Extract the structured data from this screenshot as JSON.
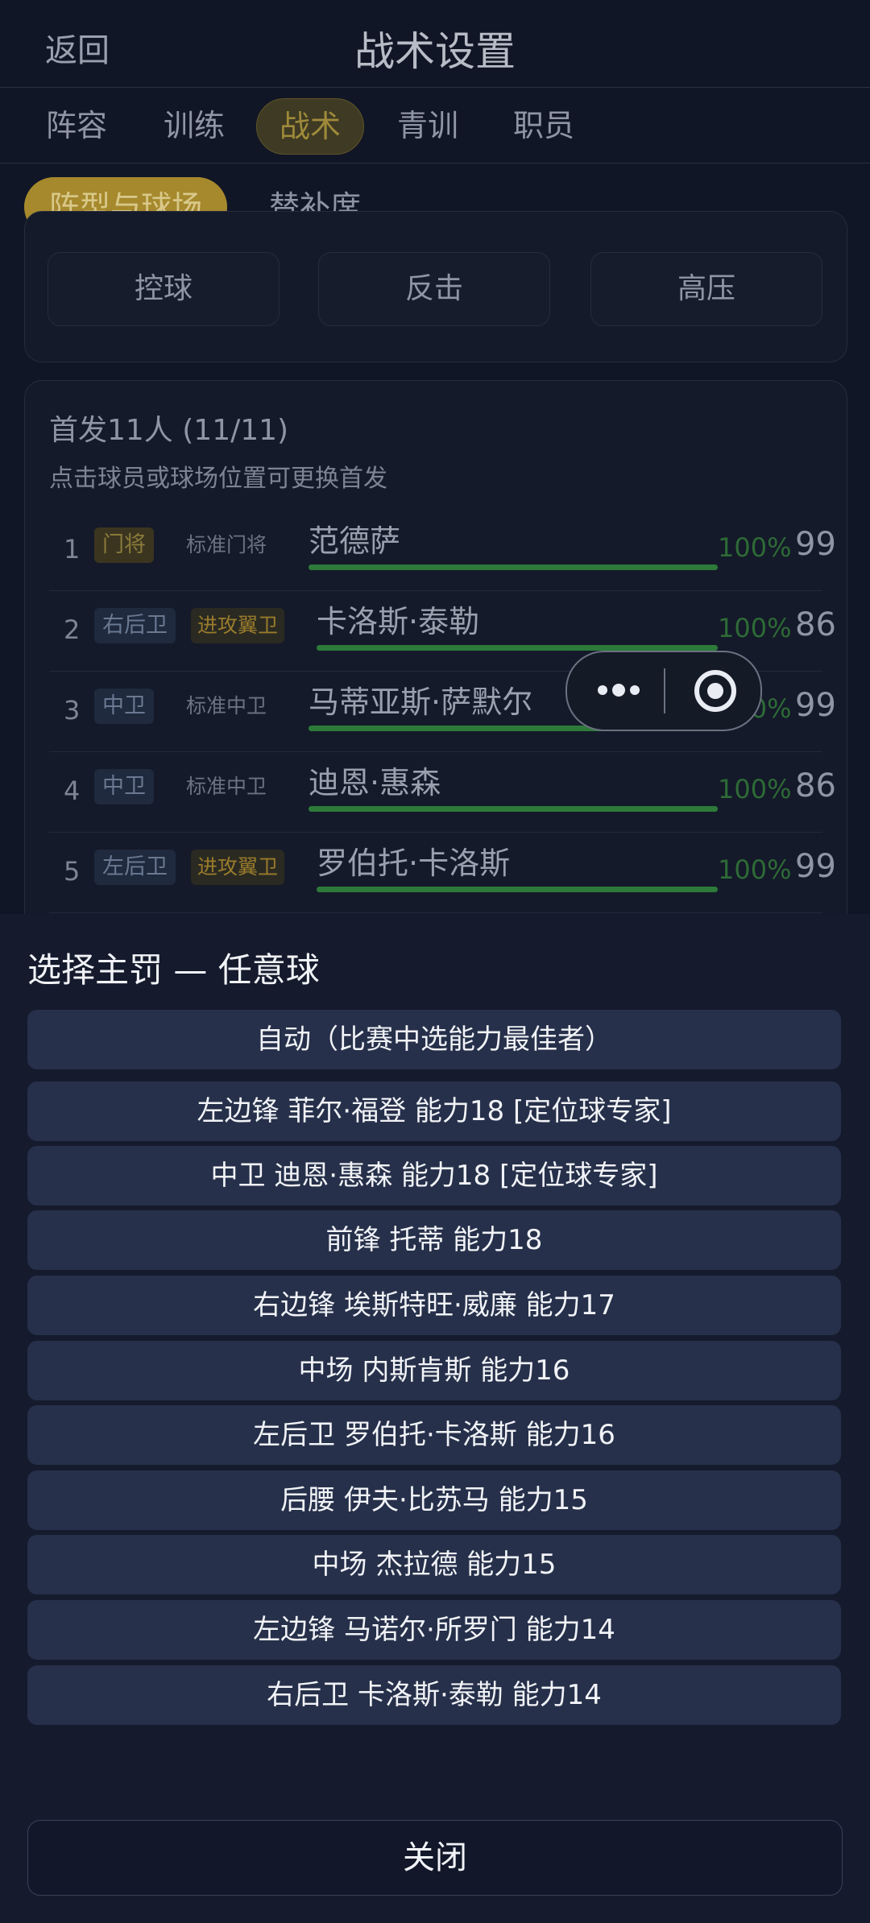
{
  "header": {
    "back_label": "返回",
    "title": "战术设置"
  },
  "tabs": [
    {
      "label": "阵容"
    },
    {
      "label": "训练"
    },
    {
      "label": "战术",
      "active": true
    },
    {
      "label": "青训"
    },
    {
      "label": "职员"
    }
  ],
  "subtabs": [
    {
      "label": "阵型与球场",
      "active": true
    },
    {
      "label": "替补席"
    }
  ],
  "styles": [
    {
      "label": "控球"
    },
    {
      "label": "反击"
    },
    {
      "label": "高压"
    }
  ],
  "lineup": {
    "title": "首发11人 (11/11)",
    "hint": "点击球员或球场位置可更换首发",
    "rows": [
      {
        "num": "1",
        "pos": "门将",
        "role": "标准门将",
        "name": "范德萨",
        "pct": "100%",
        "rating": "99",
        "fitness": 1.0
      },
      {
        "num": "2",
        "pos": "右后卫",
        "role": "进攻翼卫",
        "name": "卡洛斯·泰勒",
        "pct": "100%",
        "rating": "86",
        "fitness": 1.0
      },
      {
        "num": "3",
        "pos": "中卫",
        "role": "标准中卫",
        "name": "马蒂亚斯·萨默尔",
        "pct": "100%",
        "rating": "99",
        "fitness": 1.0
      },
      {
        "num": "4",
        "pos": "中卫",
        "role": "标准中卫",
        "name": "迪恩·惠森",
        "pct": "100%",
        "rating": "86",
        "fitness": 1.0
      },
      {
        "num": "5",
        "pos": "左后卫",
        "role": "进攻翼卫",
        "name": "罗伯托·卡洛斯",
        "pct": "100%",
        "rating": "99",
        "fitness": 1.0
      }
    ]
  },
  "sheet": {
    "title": "选择主罚 — 任意球",
    "options": [
      "自动（比赛中选能力最佳者）",
      "左边锋 菲尔·福登  能力18 [定位球专家]",
      "中卫 迪恩·惠森  能力18 [定位球专家]",
      "前锋 托蒂  能力18",
      "右边锋 埃斯特旺·威廉  能力17",
      "中场 内斯肯斯  能力16",
      "左后卫 罗伯托·卡洛斯  能力16",
      "后腰 伊夫·比苏马  能力15",
      "中场 杰拉德  能力15",
      "左边锋 马诺尔·所罗门  能力14",
      "右后卫 卡洛斯·泰勒  能力14"
    ],
    "close_label": "关闭"
  }
}
